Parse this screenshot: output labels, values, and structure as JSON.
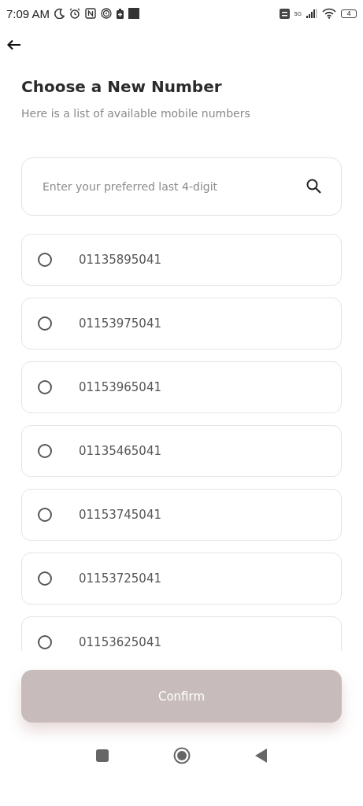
{
  "status_bar": {
    "time": "7:09 AM",
    "network": "5G",
    "battery": "4"
  },
  "title": "Choose a New Number",
  "subtitle": "Here is a list of available mobile numbers",
  "search": {
    "placeholder": "Enter your preferred last 4-digit"
  },
  "numbers": [
    {
      "number": "01135895041",
      "selected": false
    },
    {
      "number": "01153975041",
      "selected": false
    },
    {
      "number": "01153965041",
      "selected": false
    },
    {
      "number": "01135465041",
      "selected": false
    },
    {
      "number": "01153745041",
      "selected": false
    },
    {
      "number": "01153725041",
      "selected": false
    },
    {
      "number": "01153625041",
      "selected": false
    }
  ],
  "confirm": {
    "label": "Confirm",
    "disabled": true
  }
}
